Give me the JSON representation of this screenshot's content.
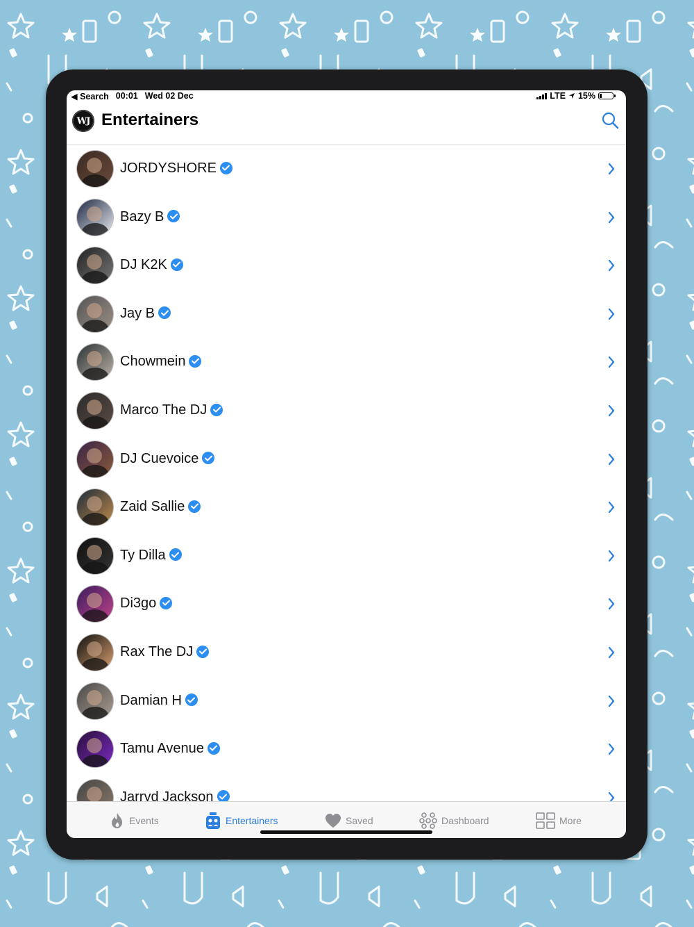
{
  "status_bar": {
    "back_label": "◀ Search",
    "time": "00:01",
    "date": "Wed 02 Dec",
    "network": "LTE",
    "battery": "15%"
  },
  "header": {
    "logo_text": "WJ",
    "title": "Entertainers"
  },
  "entertainers": [
    {
      "name": "JORDYSHORE"
    },
    {
      "name": "Bazy B"
    },
    {
      "name": "DJ K2K"
    },
    {
      "name": "Jay B"
    },
    {
      "name": "Chowmein"
    },
    {
      "name": "Marco The DJ"
    },
    {
      "name": "DJ Cuevoice"
    },
    {
      "name": "Zaid Sallie"
    },
    {
      "name": "Ty Dilla"
    },
    {
      "name": "Di3go"
    },
    {
      "name": "Rax The DJ"
    },
    {
      "name": "Damian H"
    },
    {
      "name": "Tamu Avenue"
    },
    {
      "name": "Jarryd Jackson"
    }
  ],
  "tabs": [
    {
      "label": "Events",
      "icon": "flame-icon"
    },
    {
      "label": "Entertainers",
      "icon": "entertainers-icon",
      "active": true
    },
    {
      "label": "Saved",
      "icon": "heart-icon"
    },
    {
      "label": "Dashboard",
      "icon": "dashboard-icon"
    },
    {
      "label": "More",
      "icon": "grid-icon"
    }
  ],
  "colors": {
    "accent": "#2b7fe0",
    "verified": "#2b8ef0",
    "background": "#8fc4dc",
    "inactive_tab": "#8e8e93"
  }
}
